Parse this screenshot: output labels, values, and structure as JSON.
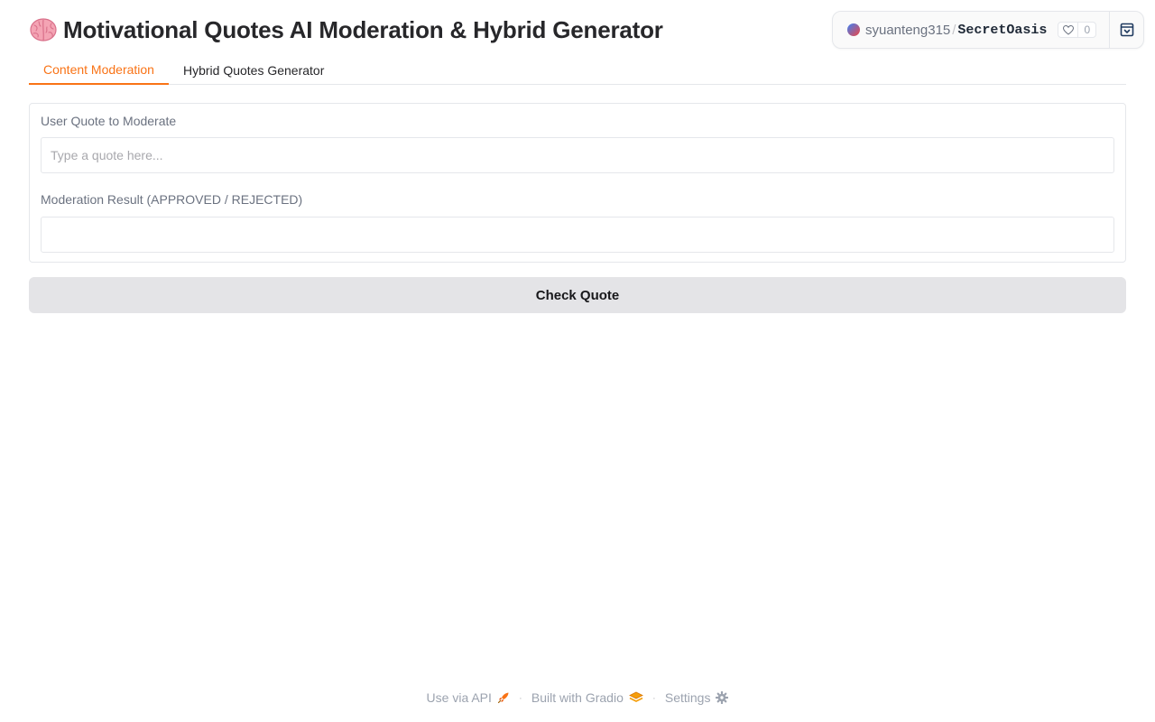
{
  "header": {
    "title": "Motivational Quotes AI Moderation & Hybrid Generator",
    "title_icon": "brain-icon"
  },
  "space_badge": {
    "user": "syuanteng315",
    "separator": "/",
    "space": "SecretOasis",
    "likes": "0"
  },
  "tabs": [
    {
      "label": "Content Moderation",
      "active": true
    },
    {
      "label": "Hybrid Quotes Generator",
      "active": false
    }
  ],
  "moderation": {
    "quote_label": "User Quote to Moderate",
    "quote_placeholder": "Type a quote here...",
    "quote_value": "",
    "result_label": "Moderation Result (APPROVED / REJECTED)",
    "result_value": "",
    "button_label": "Check Quote"
  },
  "footer": {
    "api_label": "Use via API",
    "built_label": "Built with Gradio",
    "settings_label": "Settings",
    "separator": "·"
  },
  "colors": {
    "accent": "#f97316",
    "button_bg": "#e4e4e7"
  }
}
